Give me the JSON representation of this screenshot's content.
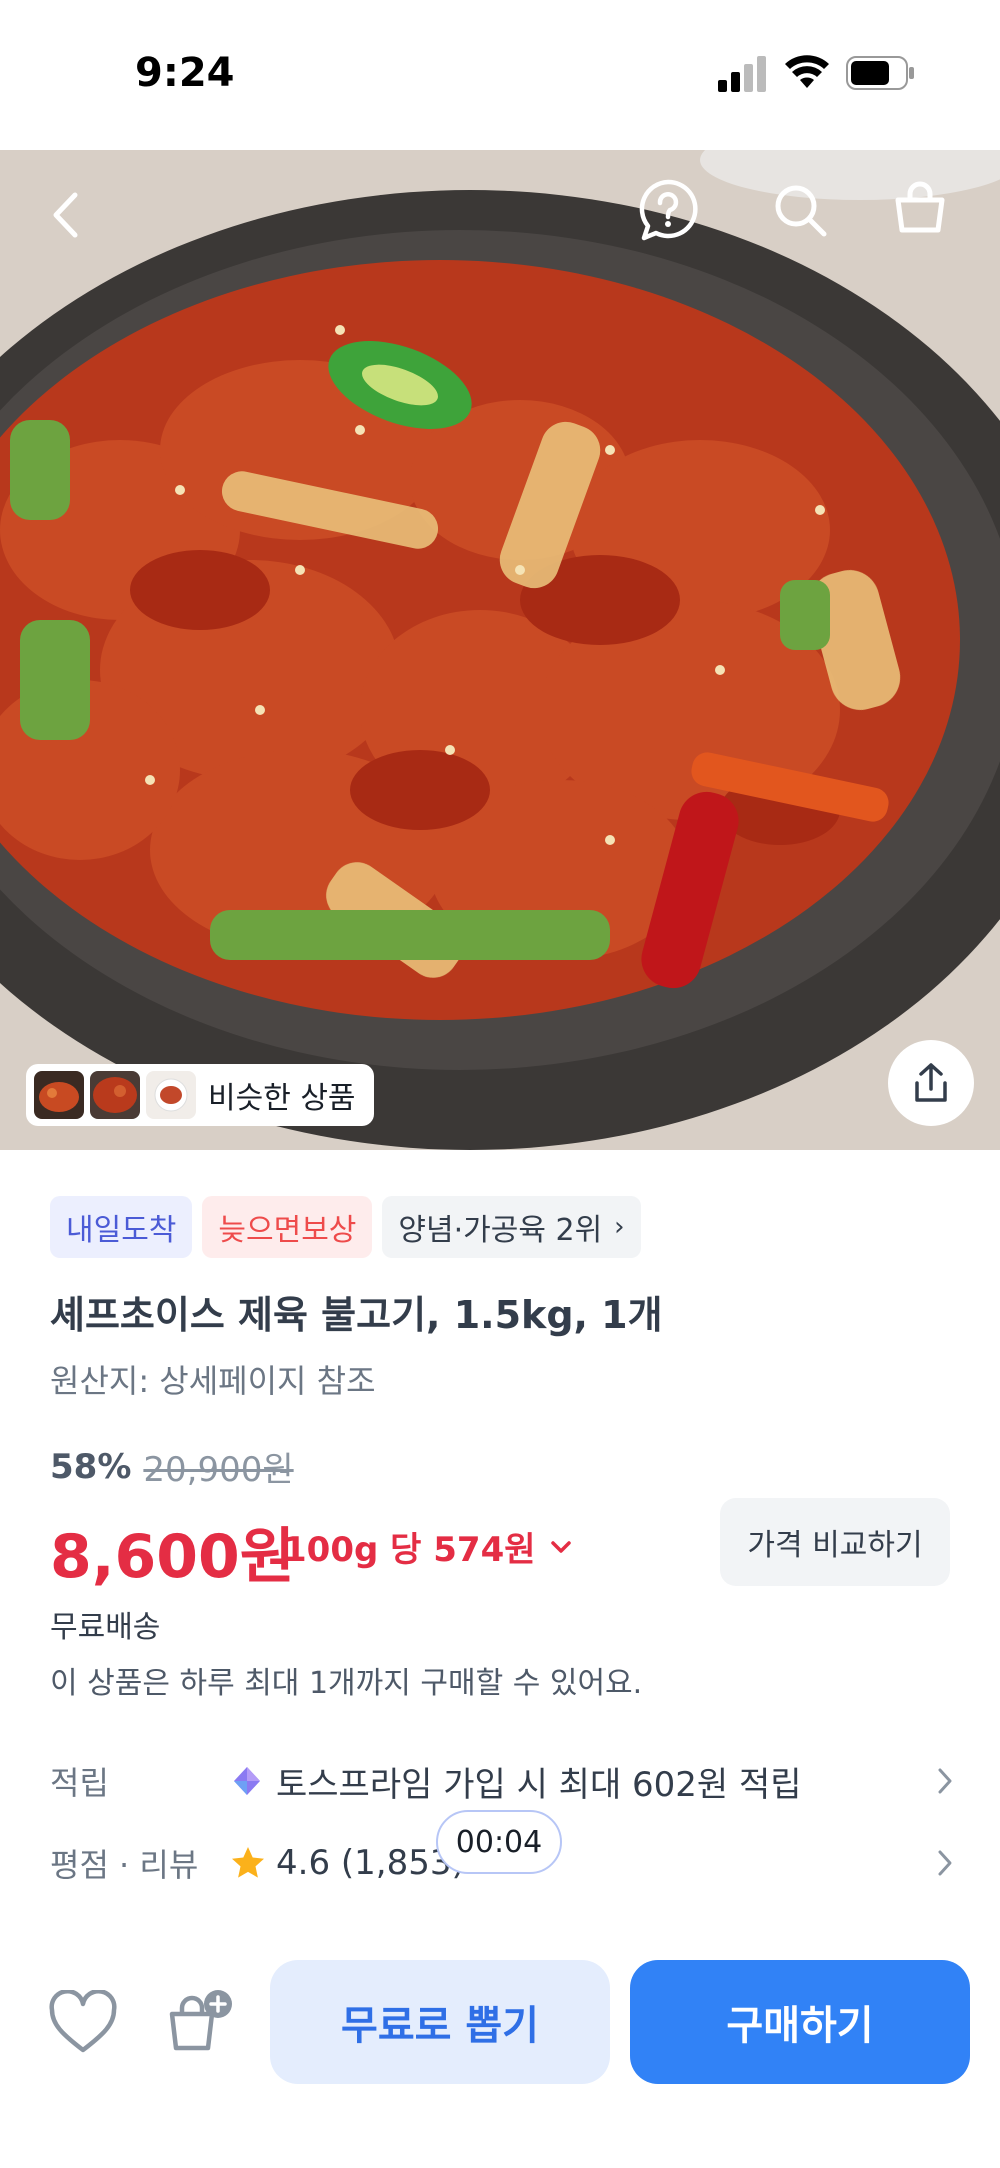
{
  "status_bar": {
    "time": "9:24"
  },
  "similar": {
    "label": "비슷한 상품"
  },
  "badges": {
    "delivery": "내일도착",
    "late": "늦으면보상",
    "rank": "양념·가공육 2위"
  },
  "product": {
    "title": "셰프초이스 제육 불고기, 1.5kg, 1개",
    "origin": "원산지: 상세페이지 참조",
    "discount": "58%",
    "original_price": "20,900원",
    "price": "8,600원",
    "unit_price": "100g 당 574원",
    "compare_label": "가격 비교하기",
    "shipping": "무료배송",
    "limit": "이 상품은 하루 최대 1개까지 구매할 수 있어요."
  },
  "info_rows": {
    "points_label": "적립",
    "points_value": "토스프라임 가입 시 최대 602원 적립",
    "review_label": "평점 · 리뷰",
    "review_value": "4.6 (1,853)"
  },
  "timer": "00:04",
  "bottom_bar": {
    "free_label": "무료로 뽑기",
    "buy_label": "구매하기"
  },
  "colors": {
    "accent_blue": "#3182f6",
    "price_red": "#e42d44",
    "rating_star": "#fbb11b"
  },
  "icons": [
    "back-icon",
    "help-icon",
    "search-icon",
    "cart-icon",
    "share-icon",
    "heart-icon",
    "gift-icon",
    "star-icon",
    "toss-prime-icon",
    "chevron-right-icon",
    "chevron-down-icon"
  ]
}
